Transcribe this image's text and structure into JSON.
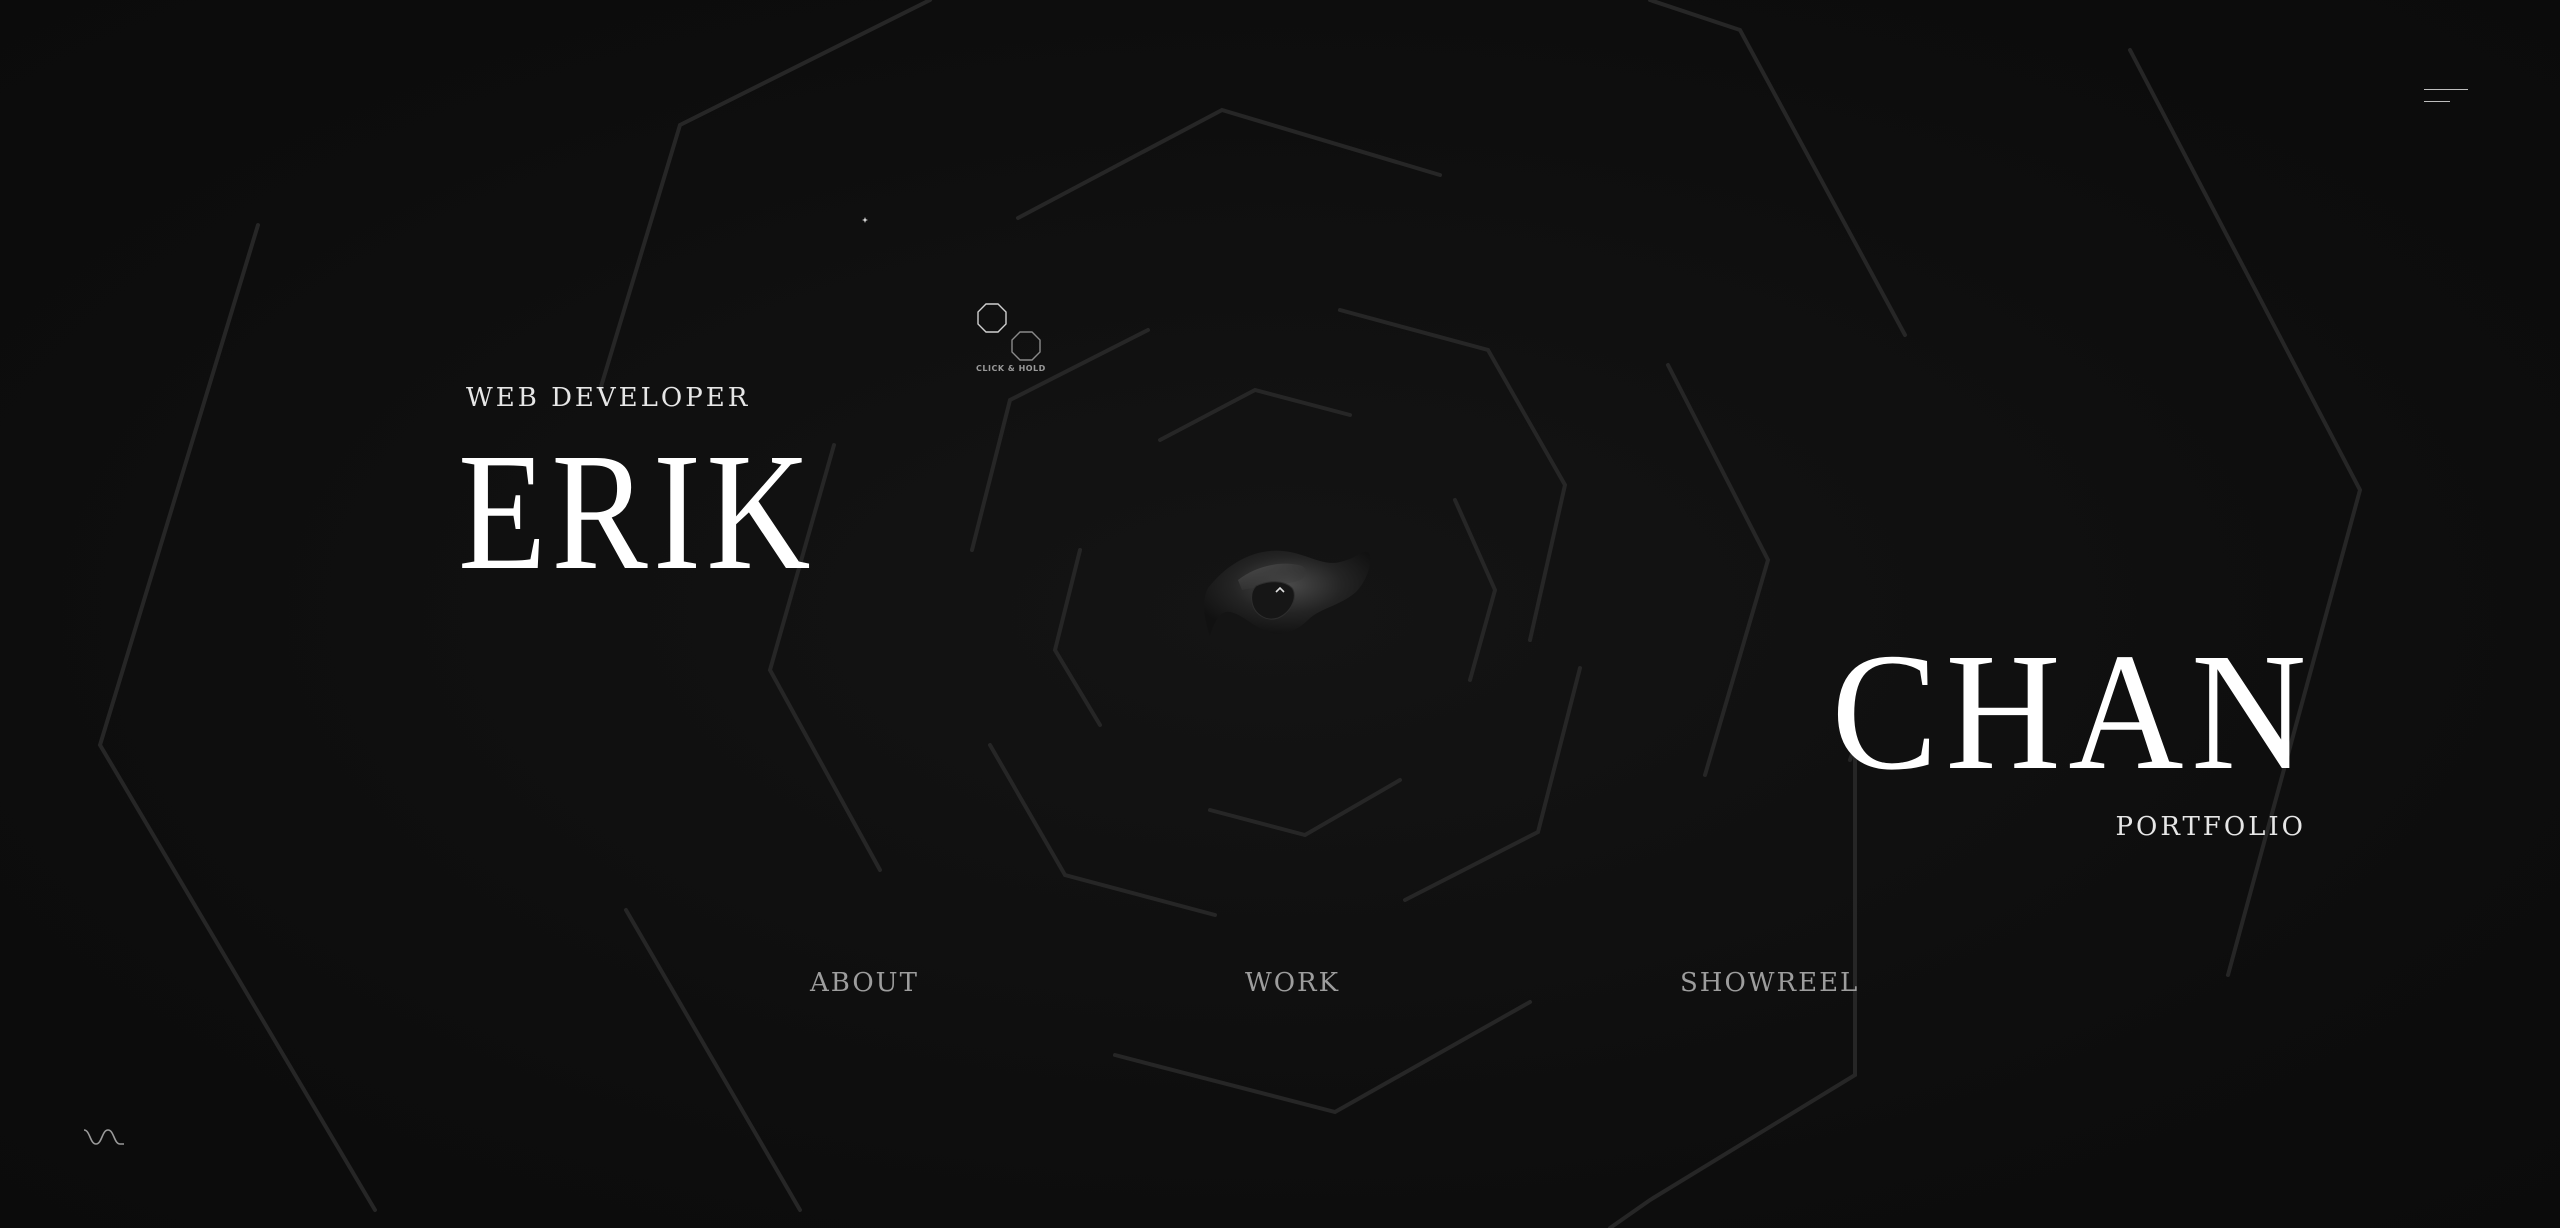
{
  "hero": {
    "role": "WEB DEVELOPER",
    "first_name": "ERIK",
    "last_name": "CHAN",
    "subtitle": "PORTFOLIO"
  },
  "nav": {
    "about": "ABOUT",
    "work": "WORK",
    "showreel": "SHOWREEL"
  },
  "hint": {
    "label": "CLICK & HOLD"
  },
  "icons": {
    "menu": "hamburger-menu-icon",
    "sound": "sound-wave-icon",
    "center": "3d-sculpture"
  },
  "colors": {
    "background": "#0e0e0e",
    "text": "#ffffff",
    "nav_text": "#9d9d9d",
    "lines": "#2a2a2a"
  }
}
